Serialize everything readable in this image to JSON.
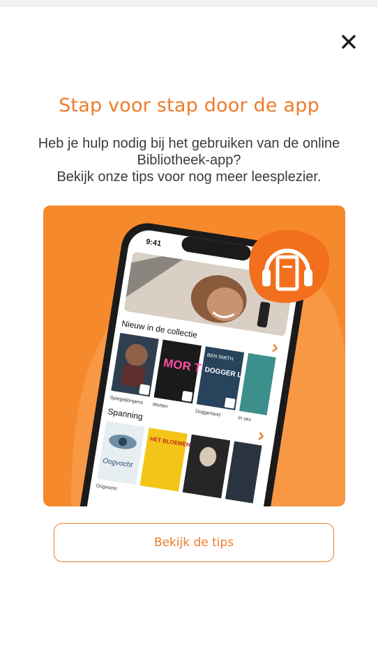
{
  "dialog": {
    "title": "Stap voor stap door de app",
    "description_lines": [
      "Heb je hulp nodig bij het gebruiken van de online",
      "Bibliotheek-app?",
      "Bekijk onze tips voor nog meer leesplezier."
    ],
    "cta_label": "Bekijk de tips",
    "close_icon": "close-icon"
  },
  "phone": {
    "clock": "9:41",
    "section_new": "Nieuw in de collectie",
    "section_thriller": "Spanning",
    "books_new": [
      {
        "title": "Spiegeljongens"
      },
      {
        "title": "Morten"
      },
      {
        "title": "Doggerland"
      },
      {
        "title": "In zev"
      }
    ],
    "books_thriller": [
      {
        "title": "Oogvocht"
      }
    ],
    "cover_texts": {
      "morten": "MOR TEN",
      "doggerland_author": "BEN SMITH",
      "doggerland": "DOGGER LAND",
      "bloemen": "HET BLOEMEN MEISJE",
      "oogvocht": "Oogvocht"
    },
    "badge_icon": "audiobook-headphones-icon"
  },
  "colors": {
    "accent": "#ef7b2a",
    "promo_bg": "#f6892c"
  }
}
